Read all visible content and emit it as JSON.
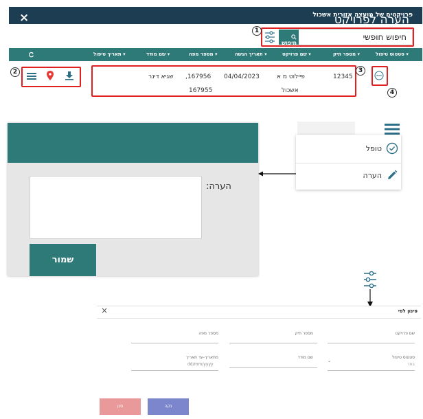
{
  "app": {
    "title": "פרויקטים של מועצה אזורית אשכול"
  },
  "search": {
    "value": "חיפוש חופשי",
    "button_label": "חיפוש"
  },
  "callouts": [
    "1",
    "2",
    "3",
    "4"
  ],
  "table": {
    "columns": [
      "סטטוס טיפול",
      "מספר תיק",
      "שם פרויקט",
      "תאריך הגשה",
      "מספר מפה",
      "שם מודד",
      "תאריך טיפול"
    ],
    "row": {
      "case_number": "12345",
      "project_name_line1": "פיילוט מ א",
      "project_name_line2": "אשכול",
      "submit_date": "04/04/2023",
      "map_number_line1": ",167956",
      "map_number_line2": "167955",
      "surveyor": "שגיא דינר"
    }
  },
  "comment_dialog": {
    "title": "הערה לפרויקט",
    "close": "×",
    "field_label": "הערה:",
    "save_label": "שמור"
  },
  "context_menu": {
    "items": [
      {
        "label": "טופל",
        "icon": "check-circle-icon"
      },
      {
        "label": "הערה",
        "icon": "pencil-icon"
      }
    ]
  },
  "filter_panel": {
    "title": "סינון לפי",
    "close": "×",
    "fields": {
      "project_name": "שם פרויקט",
      "case_number": "מספר תיק",
      "map_number": "מספר מפה",
      "status": "סטטוס טיפול",
      "status_value": "בחר",
      "surveyor": "שם מודד",
      "date_range": "מתאריך-עד תאריך",
      "date_placeholder": "dd/mm/yyyy"
    },
    "clear_label": "נקה",
    "filter_label": "סנן"
  },
  "colors": {
    "header_dark": "#1d3d52",
    "teal": "#2e7a78",
    "highlight_red": "#e02020",
    "pin_red": "#e53935",
    "filter_btn_pink": "#e9999a",
    "clear_btn_purple": "#7b86cc"
  }
}
